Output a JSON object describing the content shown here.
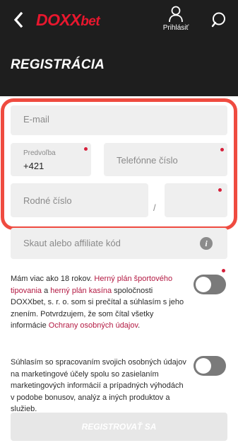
{
  "header": {
    "logo_part1": "DOXX",
    "logo_part2": "bet",
    "login_label": "Prihlásiť",
    "page_title": "REGISTRÁCIA"
  },
  "form": {
    "email_placeholder": "E-mail",
    "prefix_label": "Predvoľba",
    "prefix_value": "+421",
    "phone_placeholder": "Telefónne číslo",
    "birth_number_placeholder": "Rodné číslo",
    "slash": "/",
    "affiliate_placeholder": "Skaut alebo affiliate kód",
    "info_symbol": "i"
  },
  "consents": {
    "age": {
      "t1": "Mám viac ako 18 rokov. ",
      "link1": "Herný plán športového tipovania",
      "t2": " a ",
      "link2": "herný plán kasína",
      "t3": " spoločnosti DOXXbet, s. r. o. som si prečítal a súhlasím s jeho znením. Potvrdzujem, že som čítal všetky informácie ",
      "link3": "Ochrany osobných údajov",
      "t4": ".",
      "checked": false
    },
    "marketing": {
      "text": "Súhlasím so spracovaním svojich osobných údajov na marketingové účely spolu so zasielaním marketingových informácií a prípadných výhodách v podobe bonusov, analýz a iných produktov a služieb.",
      "checked": false
    }
  },
  "submit_label": "REGISTROVAŤ SA",
  "colors": {
    "brand": "#e8172e",
    "header_bg": "#1e1e1e",
    "highlight": "#ef4b40",
    "link": "#b31942",
    "required_dot": "#d61f3a"
  }
}
